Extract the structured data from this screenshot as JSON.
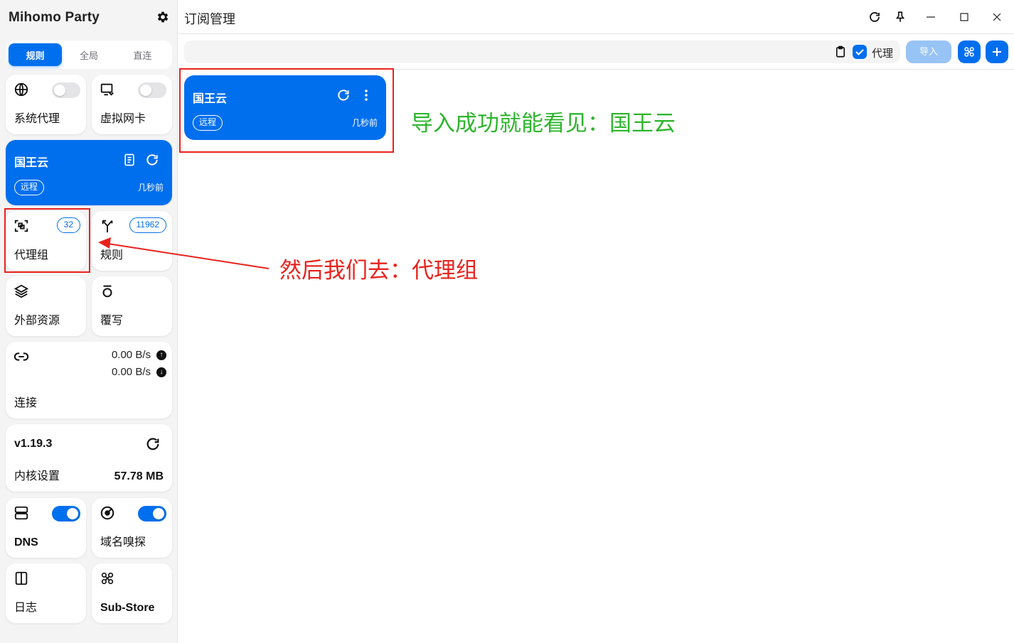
{
  "app": {
    "title": "Mihomo Party"
  },
  "mode_tabs": [
    {
      "label": "规则",
      "active": true
    },
    {
      "label": "全局",
      "active": false
    },
    {
      "label": "直连",
      "active": false
    }
  ],
  "sidebar": {
    "system_proxy": {
      "label": "系统代理",
      "enabled": false
    },
    "virtual_nic": {
      "label": "虚拟网卡",
      "enabled": false
    },
    "profile": {
      "name": "国王云",
      "tag": "远程",
      "updated": "几秒前"
    },
    "proxy_groups": {
      "label": "代理组",
      "count": "32"
    },
    "rules": {
      "label": "规则",
      "count": "11962"
    },
    "external_resources": {
      "label": "外部资源"
    },
    "override": {
      "label": "覆写"
    },
    "connections": {
      "label": "连接",
      "upload": "0.00 B/s",
      "download": "0.00 B/s"
    },
    "core": {
      "version": "v1.19.3",
      "label": "内核设置",
      "memory": "57.78 MB"
    },
    "dns": {
      "label": "DNS",
      "enabled": true
    },
    "sniff": {
      "label": "域名嗅探",
      "enabled": true
    },
    "logs": {
      "label": "日志"
    },
    "substore": {
      "label": "Sub-Store"
    }
  },
  "main": {
    "page_title": "订阅管理",
    "url_input": {
      "value": "",
      "placeholder": ""
    },
    "use_proxy": {
      "label": "代理",
      "checked": true
    },
    "import_label": "导入",
    "profiles": [
      {
        "name": "国王云",
        "tag": "远程",
        "updated": "几秒前"
      }
    ]
  },
  "annotations": {
    "success_note": "导入成功就能看见：国王云",
    "next_step_note": "然后我们去：代理组"
  },
  "colors": {
    "accent": "#006fee",
    "annotation_red": "#e8231e",
    "annotation_green": "#2db52d"
  },
  "icons": {
    "brand_gear": "gear-icon",
    "system_proxy": "globe-icon",
    "virtual_nic": "network-card-icon",
    "proxy_groups": "scan-group-icon",
    "rules": "fork-icon",
    "external_resources": "layers-icon",
    "override": "override-icon",
    "connections": "link-icon",
    "dns": "server-icon",
    "sniff": "radar-icon",
    "logs": "panel-icon",
    "substore": "substore-icon"
  }
}
